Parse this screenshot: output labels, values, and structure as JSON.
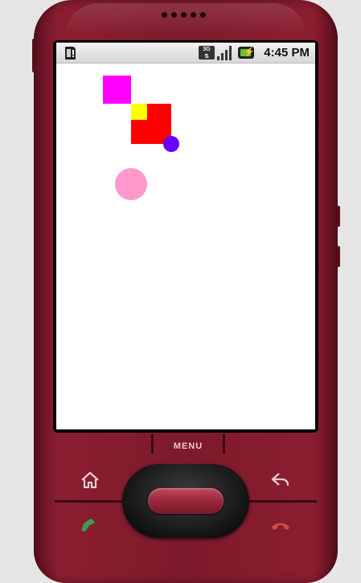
{
  "device": {
    "model_color": "#7d1a2b"
  },
  "statusbar": {
    "notification_icon": "sd-card-notification-icon",
    "network_label": "3G",
    "network_icon": "3g-data-icon",
    "signal_icon": "signal-strength-icon",
    "battery_icon": "battery-charging-icon",
    "time": "4:45 PM"
  },
  "canvas": {
    "shapes": [
      {
        "kind": "square",
        "color": "#ff00ff"
      },
      {
        "kind": "square",
        "color": "#ff0000"
      },
      {
        "kind": "square",
        "color": "#ffff00"
      },
      {
        "kind": "circle",
        "color": "#6600ff"
      },
      {
        "kind": "circle",
        "color": "#ff99cc"
      }
    ]
  },
  "hardware_keys": {
    "menu_label": "MENU",
    "home_icon": "home-icon",
    "back_icon": "back-icon",
    "call_icon": "call-icon",
    "end_call_icon": "end-call-icon",
    "trackball": "trackball"
  }
}
